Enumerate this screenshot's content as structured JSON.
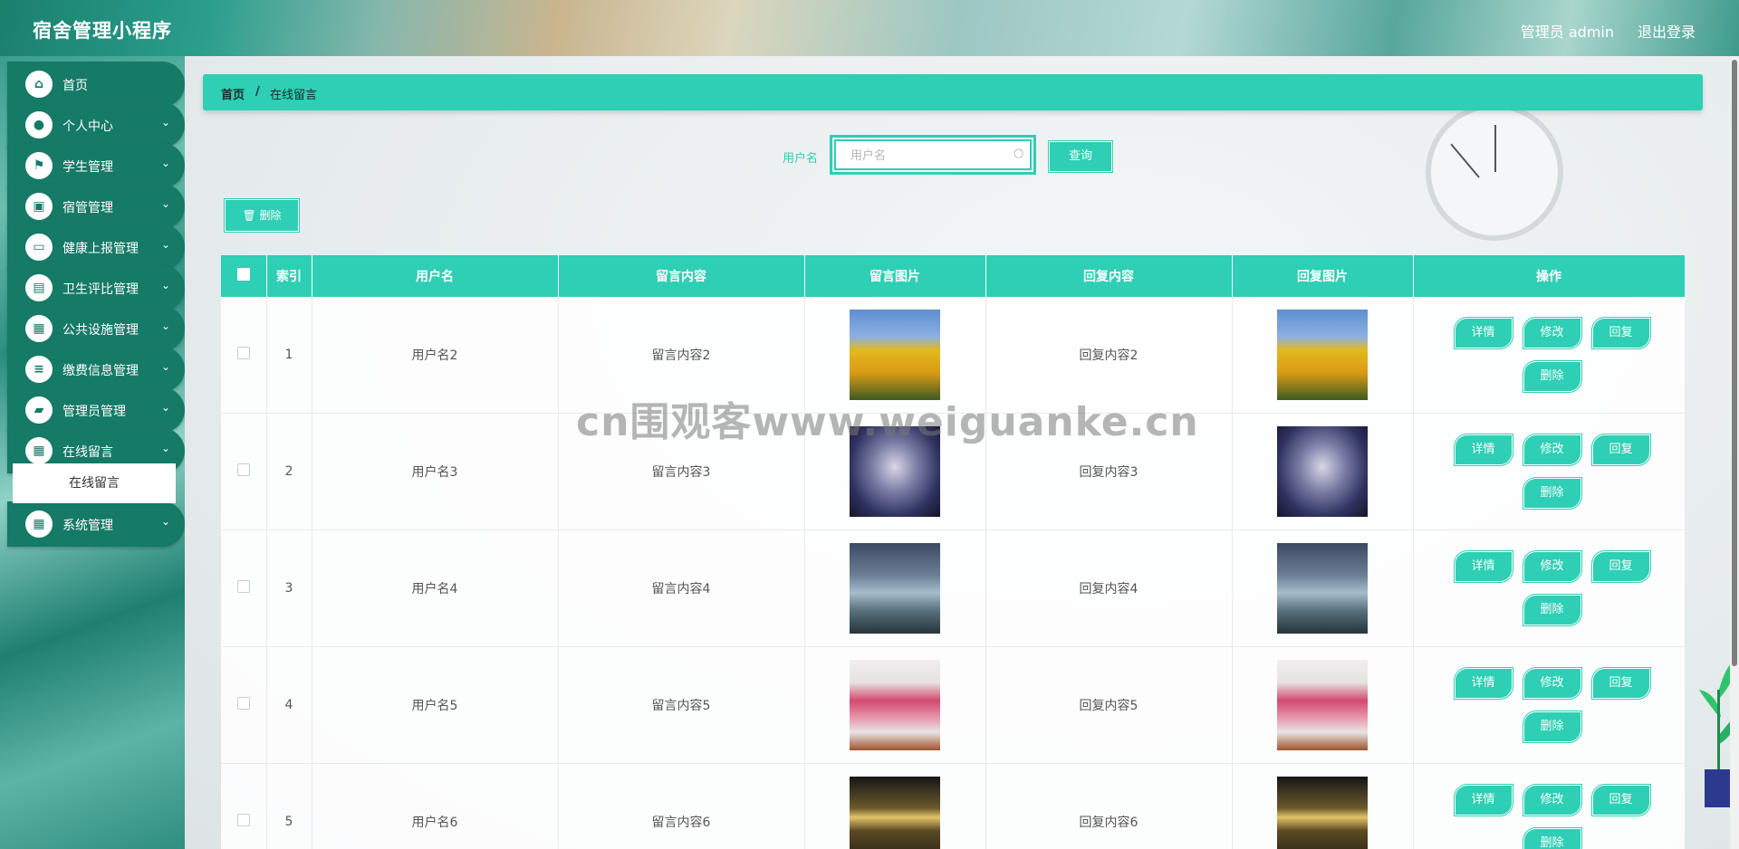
{
  "header": {
    "title": "宿舍管理小程序",
    "admin_label": "管理员 admin",
    "logout": "退出登录"
  },
  "sidebar": {
    "items": [
      {
        "label": "首页",
        "icon": "home-icon",
        "glyph": "⌂",
        "expandable": false
      },
      {
        "label": "个人中心",
        "icon": "user-icon",
        "glyph": "●",
        "expandable": true
      },
      {
        "label": "学生管理",
        "icon": "flag-icon",
        "glyph": "⚑",
        "expandable": true
      },
      {
        "label": "宿管管理",
        "icon": "clipboard-icon",
        "glyph": "▣",
        "expandable": true
      },
      {
        "label": "健康上报管理",
        "icon": "monitor-icon",
        "glyph": "▭",
        "expandable": true
      },
      {
        "label": "卫生评比管理",
        "icon": "chat-icon",
        "glyph": "▤",
        "expandable": true
      },
      {
        "label": "公共设施管理",
        "icon": "grid-icon",
        "glyph": "▦",
        "expandable": true
      },
      {
        "label": "缴费信息管理",
        "icon": "list-icon",
        "glyph": "≡",
        "expandable": true
      },
      {
        "label": "管理员管理",
        "icon": "wallet-icon",
        "glyph": "▰",
        "expandable": true
      },
      {
        "label": "在线留言",
        "icon": "grid-icon",
        "glyph": "▦",
        "expandable": true
      },
      {
        "label": "系统管理",
        "icon": "grid-icon",
        "glyph": "▦",
        "expandable": true
      }
    ],
    "submenu": {
      "label": "在线留言"
    },
    "chevron": "⌄"
  },
  "breadcrumb": {
    "home": "首页",
    "separator": "/",
    "current": "在线留言"
  },
  "search": {
    "label": "用户名",
    "placeholder": "用户名",
    "query_button": "查询"
  },
  "toolbar": {
    "delete_button": "🗑 删除"
  },
  "table": {
    "columns": [
      "",
      "索引",
      "用户名",
      "留言内容",
      "留言图片",
      "回复内容",
      "回复图片",
      "操作"
    ],
    "rows": [
      {
        "index": "1",
        "username": "用户名2",
        "content": "留言内容2",
        "reply": "回复内容2",
        "image": "sunflowers"
      },
      {
        "index": "2",
        "username": "用户名3",
        "content": "留言内容3",
        "reply": "回复内容3",
        "image": "night-sky"
      },
      {
        "index": "3",
        "username": "用户名4",
        "content": "留言内容4",
        "reply": "回复内容4",
        "image": "river-valley"
      },
      {
        "index": "4",
        "username": "用户名5",
        "content": "留言内容5",
        "reply": "回复内容5",
        "image": "pink-cloud-painting"
      },
      {
        "index": "5",
        "username": "用户名6",
        "content": "留言内容6",
        "reply": "回复内容6",
        "image": "sunset-beach"
      }
    ],
    "actions": {
      "detail": "详情",
      "edit": "修改",
      "reply": "回复",
      "delete": "删除"
    }
  },
  "watermark": "cn围观客www.weiguanke.cn",
  "colors": {
    "accent": "#2ecfb4",
    "sidebar_item": "#157a66"
  }
}
